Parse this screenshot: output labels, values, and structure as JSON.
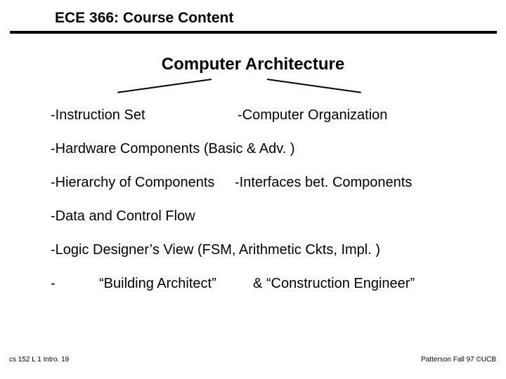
{
  "title": "ECE 366: Course Content",
  "subtitle": "Computer Architecture",
  "items": {
    "instruction_set": "-Instruction Set",
    "computer_org": "-Computer Organization",
    "hardware": "-Hardware Components (Basic & Adv. )",
    "hierarchy": "-Hierarchy of Components",
    "interfaces": "-Interfaces bet. Components",
    "dataflow": "-Data and Control Flow",
    "logic": "-Logic Designer’s View (FSM, Arithmetic Ckts, Impl. )",
    "analogy_dash": "-",
    "analogy_arch": "“Building Architect”",
    "analogy_amp": "& “Construction Engineer”"
  },
  "footer": {
    "left": "cs 152 L 1 Intro. 19",
    "right": "Patterson Fall 97 ©UCB"
  }
}
